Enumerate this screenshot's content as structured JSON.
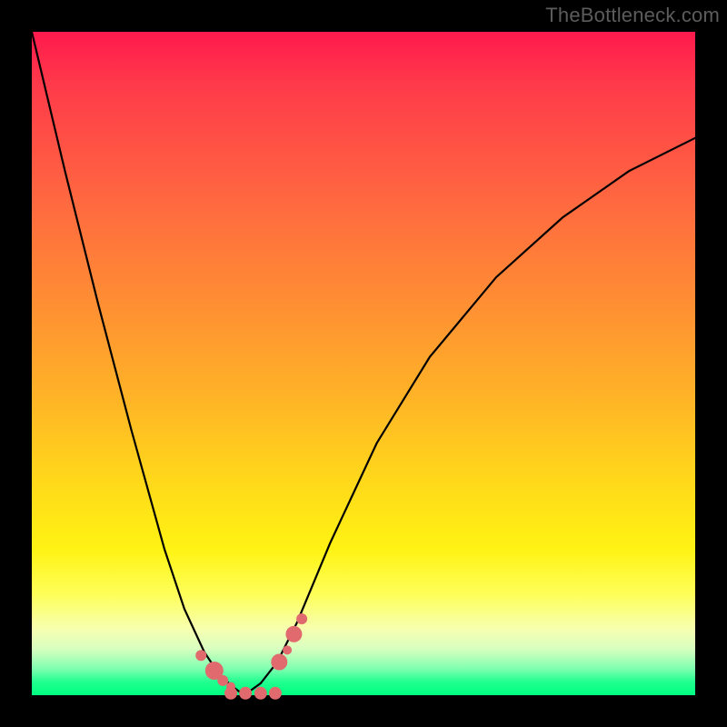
{
  "watermark": "TheBottleneck.com",
  "chart_data": {
    "type": "line",
    "title": "",
    "xlabel": "",
    "ylabel": "",
    "xlim": [
      0,
      1
    ],
    "ylim": [
      0,
      1
    ],
    "series": [
      {
        "name": "left-curve",
        "x": [
          0.0,
          0.05,
          0.1,
          0.15,
          0.2,
          0.23,
          0.26,
          0.28,
          0.3,
          0.32
        ],
        "y": [
          1.0,
          0.79,
          0.59,
          0.4,
          0.22,
          0.13,
          0.065,
          0.035,
          0.015,
          0.0
        ]
      },
      {
        "name": "right-curve",
        "x": [
          0.32,
          0.345,
          0.37,
          0.4,
          0.45,
          0.52,
          0.6,
          0.7,
          0.8,
          0.9,
          1.0
        ],
        "y": [
          0.0,
          0.018,
          0.05,
          0.11,
          0.23,
          0.38,
          0.51,
          0.63,
          0.72,
          0.79,
          0.84
        ]
      }
    ],
    "markers": [
      {
        "x": 0.255,
        "y": 0.06,
        "r": 6
      },
      {
        "x": 0.275,
        "y": 0.037,
        "r": 10
      },
      {
        "x": 0.288,
        "y": 0.022,
        "r": 6
      },
      {
        "x": 0.3,
        "y": 0.013,
        "r": 5
      },
      {
        "x": 0.3,
        "y": 0.003,
        "r": 7
      },
      {
        "x": 0.322,
        "y": 0.003,
        "r": 7
      },
      {
        "x": 0.345,
        "y": 0.003,
        "r": 7
      },
      {
        "x": 0.367,
        "y": 0.003,
        "r": 7
      },
      {
        "x": 0.373,
        "y": 0.05,
        "r": 9
      },
      {
        "x": 0.385,
        "y": 0.068,
        "r": 5
      },
      {
        "x": 0.395,
        "y": 0.092,
        "r": 9
      },
      {
        "x": 0.407,
        "y": 0.115,
        "r": 6
      }
    ],
    "colors": {
      "curve": "#000000",
      "marker": "#e06a6d"
    }
  }
}
